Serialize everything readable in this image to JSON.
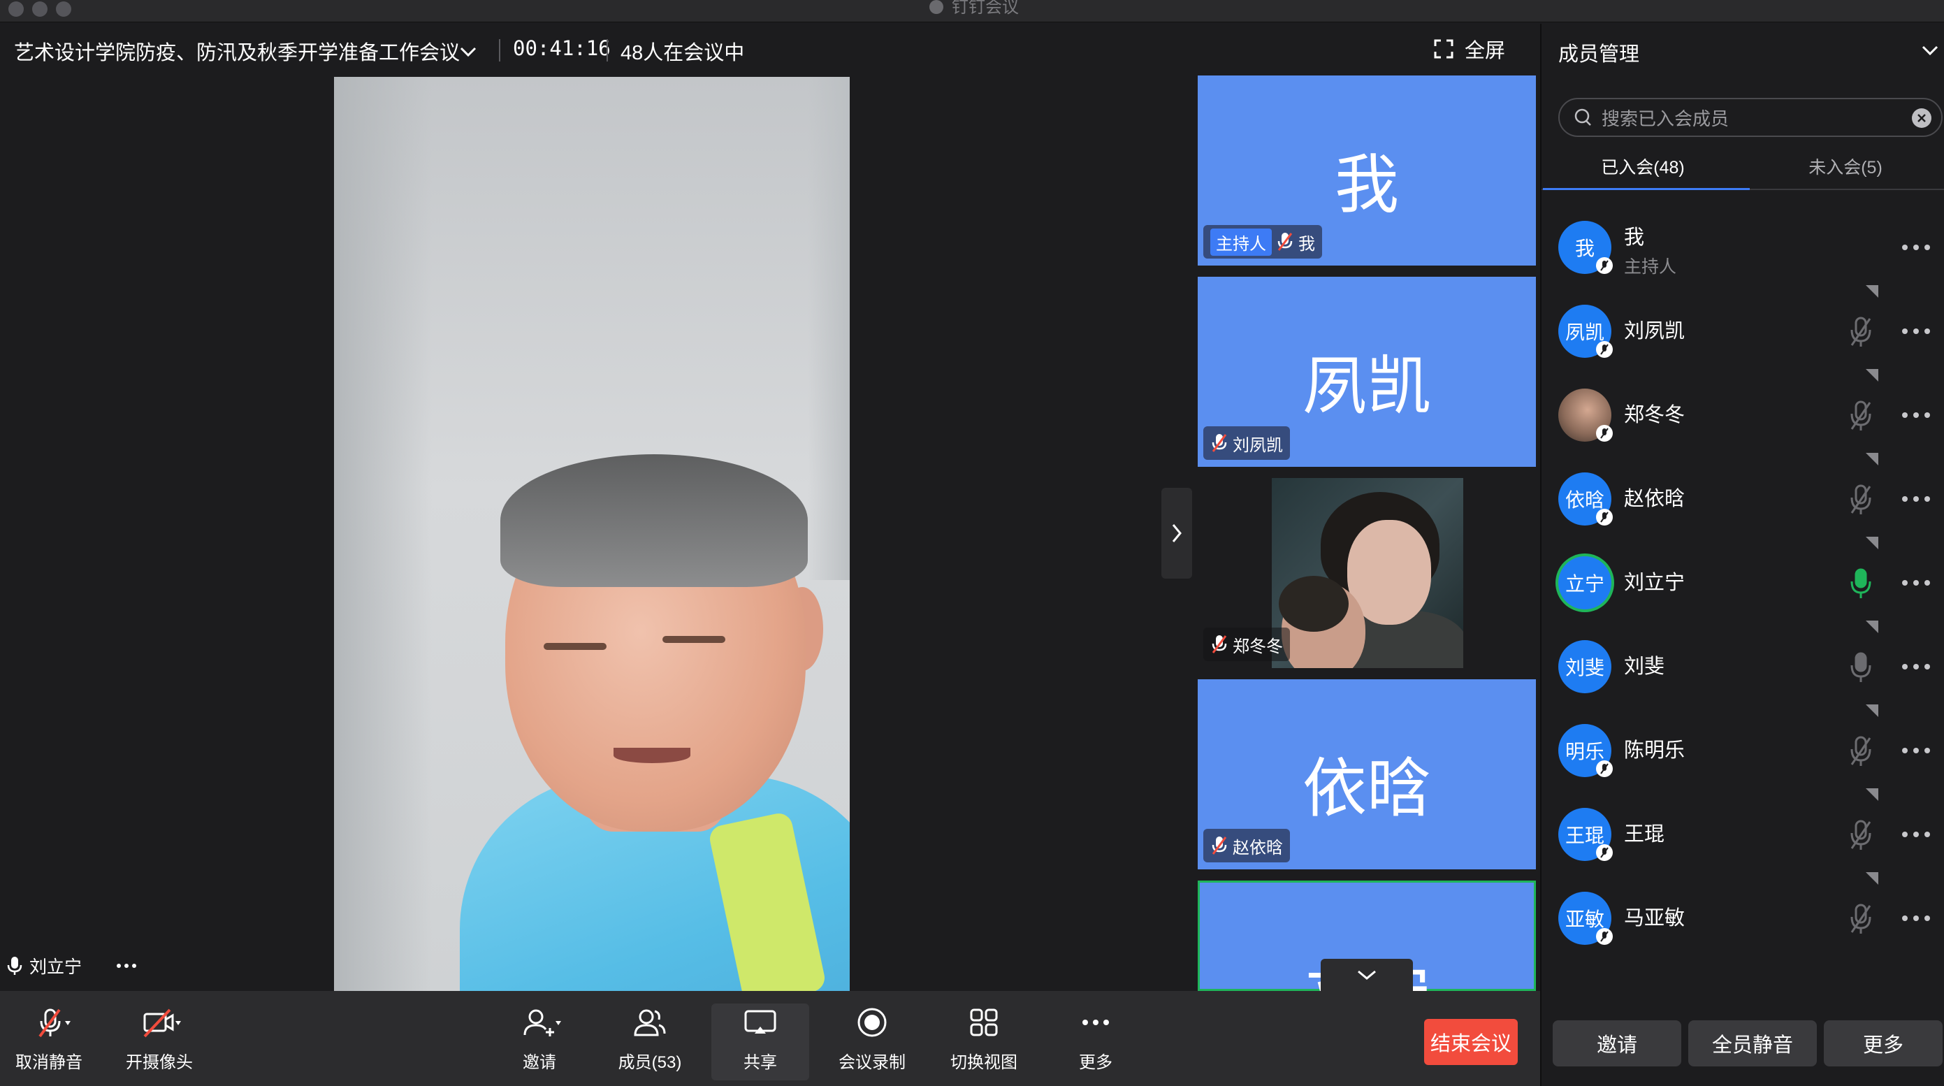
{
  "window": {
    "title": "钉钉会议"
  },
  "header": {
    "meeting_title": "艺术设计学院防疫、防汛及秋季开学准备工作会议",
    "timer": "00:41:16",
    "attendance": "48人在会议中",
    "fullscreen_label": "全屏"
  },
  "stage": {
    "speaker_name": "刘立宁"
  },
  "tiles": [
    {
      "big": "我",
      "host_badge": "主持人",
      "label": "我"
    },
    {
      "big": "夙凯",
      "label": "刘夙凯"
    },
    {
      "big": "",
      "label": "郑冬冬"
    },
    {
      "big": "依晗",
      "label": "赵依晗"
    },
    {
      "big": "立宁",
      "label": ""
    }
  ],
  "toolbar": {
    "unmute": "取消静音",
    "camera": "开摄像头",
    "invite": "邀请",
    "members": "成员(53)",
    "share": "共享",
    "record": "会议录制",
    "switch_view": "切换视图",
    "more": "更多",
    "end": "结束会议"
  },
  "panel": {
    "title": "成员管理",
    "search_placeholder": "搜索已入会成员",
    "tab_joined": "已入会(48)",
    "tab_not_joined": "未入会(5)",
    "members": [
      {
        "avatar": "我",
        "name": "我",
        "role": "主持人",
        "mic": "none"
      },
      {
        "avatar": "夙凯",
        "name": "刘夙凯",
        "role": "",
        "mic": "muted"
      },
      {
        "avatar": "",
        "name": "郑冬冬",
        "role": "",
        "mic": "muted"
      },
      {
        "avatar": "依晗",
        "name": "赵依晗",
        "role": "",
        "mic": "muted"
      },
      {
        "avatar": "立宁",
        "name": "刘立宁",
        "role": "",
        "mic": "speaking"
      },
      {
        "avatar": "刘斐",
        "name": "刘斐",
        "role": "",
        "mic": "on"
      },
      {
        "avatar": "明乐",
        "name": "陈明乐",
        "role": "",
        "mic": "muted"
      },
      {
        "avatar": "王琨",
        "name": "王琨",
        "role": "",
        "mic": "muted"
      },
      {
        "avatar": "亚敏",
        "name": "马亚敏",
        "role": "",
        "mic": "muted"
      }
    ],
    "buttons": {
      "invite": "邀请",
      "mute_all": "全员静音",
      "more": "更多"
    }
  },
  "colors": {
    "accent_blue": "#3d7bf5",
    "tile_blue": "#5b8ff0",
    "end_red": "#f24c3d",
    "speaking_green": "#1fb55a",
    "muted_red": "#f24c3d"
  }
}
